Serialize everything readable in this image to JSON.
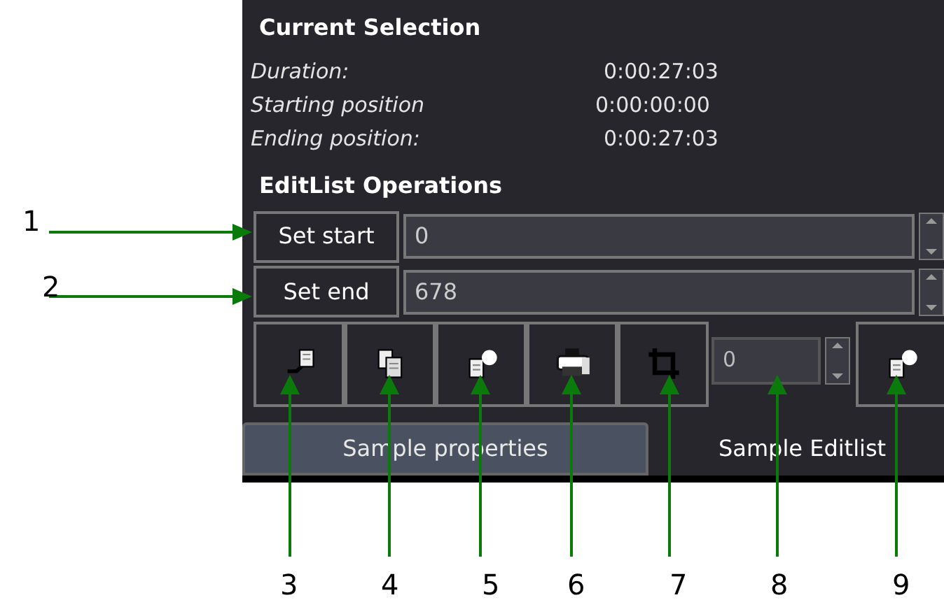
{
  "current_selection": {
    "title": "Current Selection",
    "fields": [
      {
        "label": "Duration:",
        "value": "0:00:27:03"
      },
      {
        "label": "Starting position",
        "value": "0:00:00:00"
      },
      {
        "label": "Ending position:",
        "value": "0:00:27:03"
      }
    ]
  },
  "editlist_operations": {
    "title": "EditList Operations",
    "rows": [
      {
        "button": "Set start",
        "value": "0"
      },
      {
        "button": "Set end",
        "value": "678"
      }
    ],
    "tools": [
      {
        "kind": "insert"
      },
      {
        "kind": "pages"
      },
      {
        "kind": "paste"
      },
      {
        "kind": "printer"
      },
      {
        "kind": "crop"
      },
      {
        "kind": "counter",
        "value": "0"
      },
      {
        "kind": "paste"
      }
    ]
  },
  "tabs": [
    {
      "label": "Sample properties",
      "selected": false
    },
    {
      "label": "Sample Editlist",
      "selected": true
    }
  ],
  "callouts": [
    "1",
    "2",
    "3",
    "4",
    "5",
    "6",
    "7",
    "8",
    "9"
  ]
}
